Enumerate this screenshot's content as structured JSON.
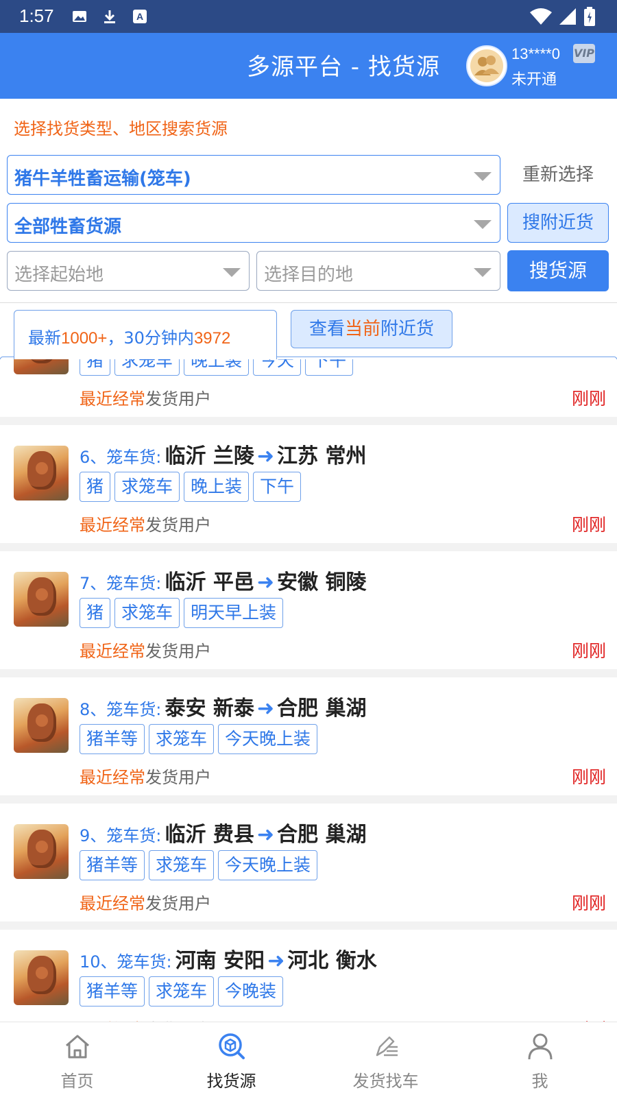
{
  "status_bar": {
    "time": "1:57"
  },
  "header": {
    "title": "多源平台 - 找货源",
    "user_id": "13****0",
    "user_status": "未开通",
    "vip_label": "VIP"
  },
  "filters": {
    "hint": "选择找货类型、地区搜索货源",
    "category_value": "猪牛羊牲畜运输(笼车)",
    "reset_label": "重新选择",
    "subcategory_value": "全部牲畜货源",
    "nearby_label": "搜附近货",
    "origin_placeholder": "选择起始地",
    "destination_placeholder": "选择目的地",
    "search_label": "搜货源"
  },
  "tabs": {
    "active_prefix": "最新",
    "active_count": "1000+",
    "active_mid": "，30分钟内",
    "active_recent": "3972",
    "other_prefix": "查看",
    "other_highlight": "当前",
    "other_suffix": "附近货"
  },
  "list": {
    "meta_highlight": "最近经常",
    "meta_rest": "发货用户",
    "items": [
      {
        "index": "",
        "from": "",
        "to": "",
        "tags": [
          "猪",
          "求笼车",
          "晚上装",
          "今天",
          "下午"
        ],
        "time": "刚刚"
      },
      {
        "index": "6、笼车货:",
        "from": "临沂 兰陵",
        "to": "江苏 常州",
        "tags": [
          "猪",
          "求笼车",
          "晚上装",
          "下午"
        ],
        "time": "刚刚"
      },
      {
        "index": "7、笼车货:",
        "from": "临沂 平邑",
        "to": "安徽 铜陵",
        "tags": [
          "猪",
          "求笼车",
          "明天早上装"
        ],
        "time": "刚刚"
      },
      {
        "index": "8、笼车货:",
        "from": "泰安 新泰",
        "to": "合肥 巢湖",
        "tags": [
          "猪羊等",
          "求笼车",
          "今天晚上装"
        ],
        "time": "刚刚"
      },
      {
        "index": "9、笼车货:",
        "from": "临沂 费县",
        "to": "合肥 巢湖",
        "tags": [
          "猪羊等",
          "求笼车",
          "今天晚上装"
        ],
        "time": "刚刚"
      },
      {
        "index": "10、笼车货:",
        "from": "河南 安阳",
        "to": "河北 衡水",
        "tags": [
          "猪羊等",
          "求笼车",
          "今晚装"
        ],
        "time": "刚刚"
      }
    ]
  },
  "bottom_nav": [
    {
      "label": "首页",
      "icon": "home-icon"
    },
    {
      "label": "找货源",
      "icon": "find-cargo-icon"
    },
    {
      "label": "发货找车",
      "icon": "post-cargo-icon"
    },
    {
      "label": "我",
      "icon": "user-icon"
    }
  ],
  "colors": {
    "primary": "#3b82f0",
    "status_bar": "#2c4a86",
    "orange": "#f06417",
    "red": "#e02020"
  }
}
